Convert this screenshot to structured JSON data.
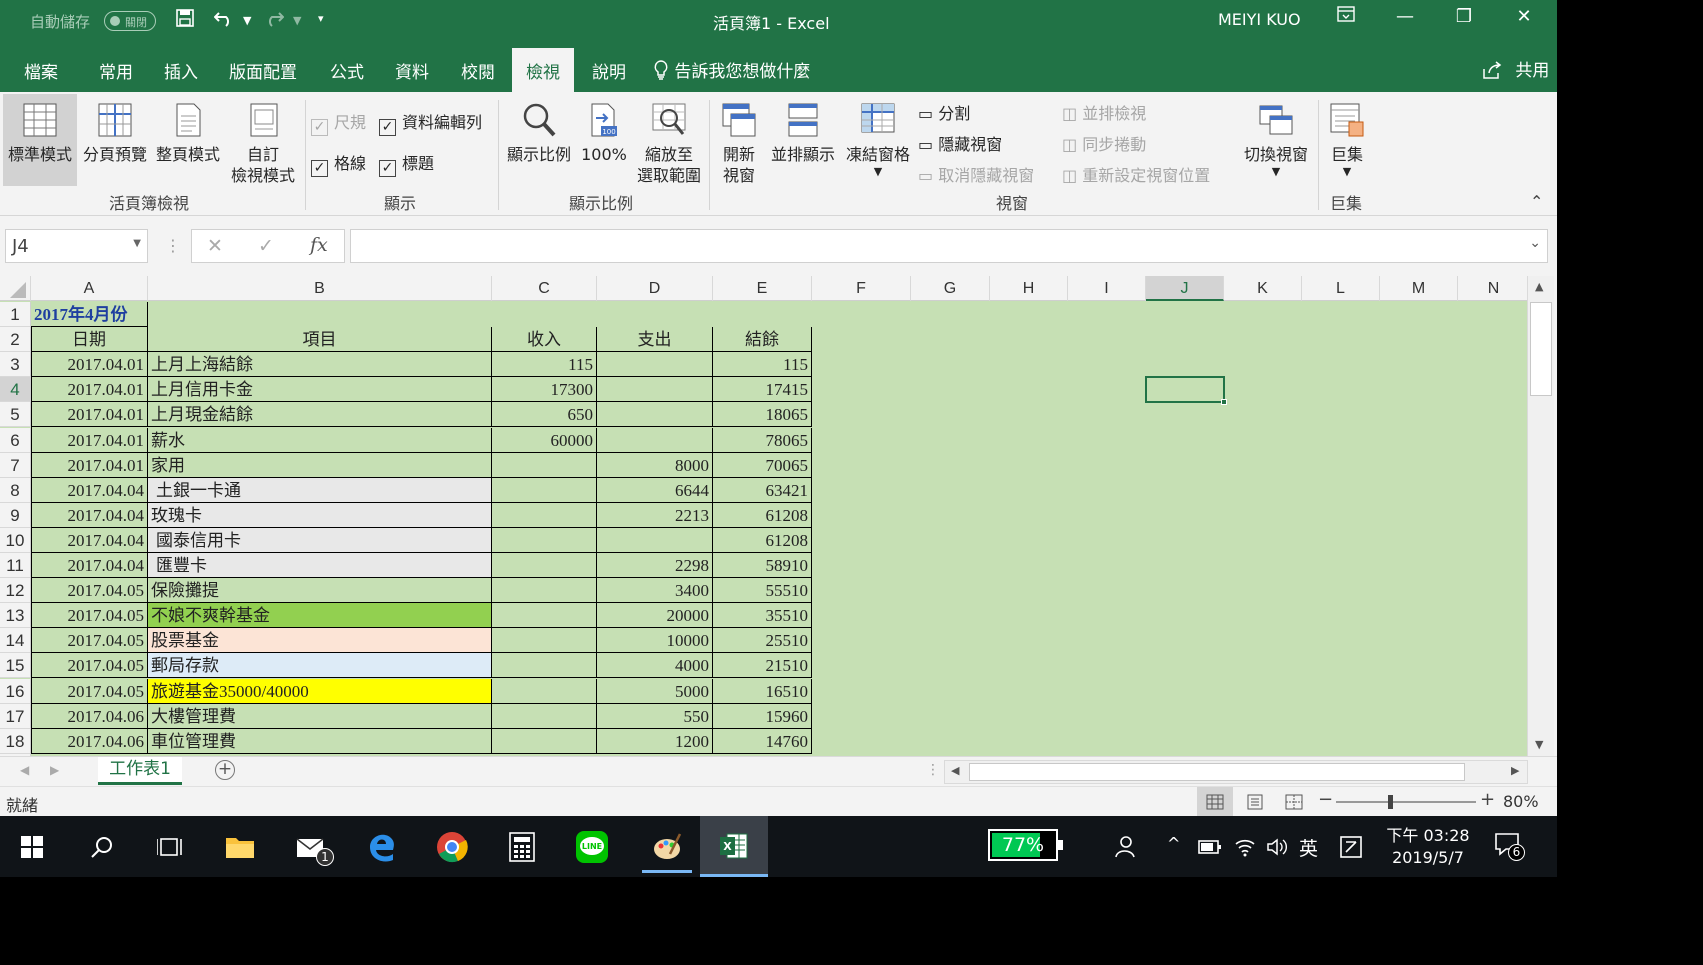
{
  "window": {
    "autosave_label": "自動儲存",
    "autosave_state": "關閉",
    "title": "活頁簿1  -  Excel",
    "user": "MEIYI KUO"
  },
  "tabs": [
    "檔案",
    "常用",
    "插入",
    "版面配置",
    "公式",
    "資料",
    "校閱",
    "檢視",
    "說明"
  ],
  "active_tab": "檢視",
  "tell_me": "告訴我您想做什麼",
  "share": "共用",
  "ribbon": {
    "workbook_views": {
      "group": "活頁簿檢視",
      "normal": "標準模式",
      "page_break": "分頁預覽",
      "page_layout": "整頁模式",
      "custom_1": "自訂",
      "custom_2": "檢視模式"
    },
    "show": {
      "group": "顯示",
      "ruler": "尺規",
      "formula_bar": "資料編輯列",
      "gridlines": "格線",
      "headings": "標題"
    },
    "zoom": {
      "group": "顯示比例",
      "zoom": "顯示比例",
      "hundred": "100%",
      "hundred_badge": "100",
      "zoom_sel_1": "縮放至",
      "zoom_sel_2": "選取範圍"
    },
    "window": {
      "group": "視窗",
      "new_1": "開新",
      "new_2": "視窗",
      "arrange": "並排顯示",
      "freeze": "凍結窗格",
      "split": "分割",
      "hide": "隱藏視窗",
      "unhide": "取消隱藏視窗",
      "side_by_side": "並排檢視",
      "sync_scroll": "同步捲動",
      "reset_pos": "重新設定視窗位置",
      "switch": "切換視窗"
    },
    "macros": {
      "group": "巨集",
      "macros": "巨集"
    }
  },
  "formula_bar": {
    "name_box": "J4",
    "fx": "fx",
    "content": ""
  },
  "columns": [
    "A",
    "B",
    "C",
    "D",
    "E",
    "F",
    "G",
    "H",
    "I",
    "J",
    "K",
    "L",
    "M",
    "N"
  ],
  "selected_cell": "J4",
  "sheet": {
    "title": "2017年4月份",
    "headers": [
      "日期",
      "項目",
      "收入",
      "支出",
      "結餘"
    ],
    "rows": [
      {
        "row": "3",
        "date": "2017.04.01",
        "item": "上月上海結餘",
        "income": "115",
        "expense": "",
        "balance": "115"
      },
      {
        "row": "4",
        "date": "2017.04.01",
        "item": "上月信用卡金",
        "income": "17300",
        "expense": "",
        "balance": "17415"
      },
      {
        "row": "5",
        "date": "2017.04.01",
        "item": "上月現金結餘",
        "income": "650",
        "expense": "",
        "balance": "18065"
      },
      {
        "row": "6",
        "date": "2017.04.01",
        "item": "薪水",
        "income": "60000",
        "expense": "",
        "balance": "78065"
      },
      {
        "row": "7",
        "date": "2017.04.01",
        "item": "家用",
        "income": "",
        "expense": "8000",
        "balance": "70065"
      },
      {
        "row": "8",
        "date": "2017.04.04",
        "item": "土銀一卡通",
        "income": "",
        "expense": "6644",
        "balance": "63421"
      },
      {
        "row": "9",
        "date": "2017.04.04",
        "item": "玫瑰卡",
        "income": "",
        "expense": "2213",
        "balance": "61208"
      },
      {
        "row": "10",
        "date": "2017.04.04",
        "item": "國泰信用卡",
        "income": "",
        "expense": "",
        "balance": "61208"
      },
      {
        "row": "11",
        "date": "2017.04.04",
        "item": "匯豐卡",
        "income": "",
        "expense": "2298",
        "balance": "58910"
      },
      {
        "row": "12",
        "date": "2017.04.05",
        "item": "保險攤提",
        "income": "",
        "expense": "3400",
        "balance": "55510"
      },
      {
        "row": "13",
        "date": "2017.04.05",
        "item": "不娘不爽幹基金",
        "income": "",
        "expense": "20000",
        "balance": "35510"
      },
      {
        "row": "14",
        "date": "2017.04.05",
        "item": "股票基金",
        "income": "",
        "expense": "10000",
        "balance": "25510"
      },
      {
        "row": "15",
        "date": "2017.04.05",
        "item": "郵局存款",
        "income": "",
        "expense": "4000",
        "balance": "21510"
      },
      {
        "row": "16",
        "date": "2017.04.05",
        "item": "旅遊基金35000/40000",
        "income": "",
        "expense": "5000",
        "balance": "16510"
      },
      {
        "row": "17",
        "date": "2017.04.06",
        "item": "大樓管理費",
        "income": "",
        "expense": "550",
        "balance": "15960"
      },
      {
        "row": "18",
        "date": "2017.04.06",
        "item": "車位管理費",
        "income": "",
        "expense": "1200",
        "balance": "14760"
      }
    ]
  },
  "sheet_tab": "工作表1",
  "status": {
    "ready": "就緒",
    "zoom": "80%",
    "zoom_level": 0.8
  },
  "taskbar": {
    "battery": "77%",
    "ime": "英",
    "time": "下午 03:28",
    "date": "2019/5/7",
    "mail_badge": "1",
    "notif_badge": "6"
  },
  "colors": {
    "excel_green": "#217346",
    "sheet_fill": "#c6e0b4",
    "item_gray": "#e8e8e8",
    "item_green": "#92d050",
    "item_peach": "#fce4d6",
    "item_blue": "#ddebf7",
    "item_yellow": "#ffff00",
    "title_blue": "#1f3fa0"
  }
}
